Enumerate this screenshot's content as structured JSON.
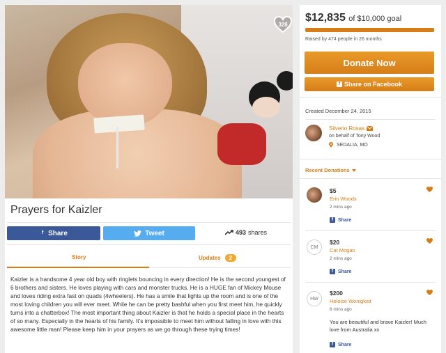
{
  "campaign": {
    "title": "Prayers for Kaizler",
    "heart_count": "328",
    "story": "Kaizler is a handsome 4 year old boy with ringlets bouncing in every direction! He is the second youngest of 6 brothers and sisters. He loves playing with cars and monster trucks. He is a HUGE fan of Mickey Mouse and loves riding extra fast on quads (4wheelers). He has a smile that lights up the room and is one of the most loving children you will ever meet. While he can be pretty bashful when you first meet him, he quickly turns into a chatterbox! The most important thing about Kaizler is that he holds a special place in the hearts of so many. Especially in the hearts of his family. It's impossible to meet him without falling in love with this awesome little man! Please keep him in your prayers as we go through these trying times!"
  },
  "share_bar": {
    "facebook_label": "Share",
    "twitter_label": "Tweet",
    "shares_count": "493",
    "shares_label": "shares"
  },
  "tabs": {
    "story_label": "Story",
    "updates_label": "Updates",
    "updates_count": "2"
  },
  "funding": {
    "amount": "$12,835",
    "goal_text": "of $10,000 goal",
    "progress_percent": 100,
    "raised_by": "Raised by 474 people in 26 months",
    "donate_label": "Donate Now",
    "share_facebook_label": "Share on Facebook"
  },
  "organizer": {
    "created": "Created December 24, 2015",
    "name": "Silverio Rosas",
    "behalf": "on behalf of Tony Wood",
    "location": "SEDALIA, MO"
  },
  "recent": {
    "label": "Recent Donations",
    "share_label": "Share",
    "items": [
      {
        "amount": "$5",
        "name": "Erin Woods",
        "time": "2 mins ago",
        "initials": "",
        "message": ""
      },
      {
        "amount": "$20",
        "name": "Cat Mogan",
        "time": "2 mins ago",
        "initials": "CM",
        "message": ""
      },
      {
        "amount": "$200",
        "name": "Heloise Wonigkeit",
        "time": "8 mins ago",
        "initials": "HW",
        "message": "You are beautiful and brave Kaizler! Much love from Australia xx"
      }
    ]
  },
  "colors": {
    "accent": "#d67d17",
    "facebook": "#3b5998",
    "twitter": "#55acee"
  }
}
